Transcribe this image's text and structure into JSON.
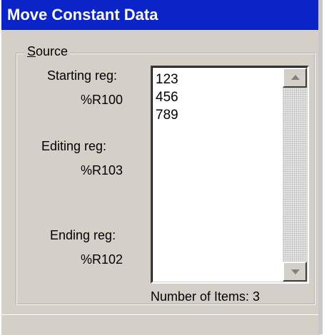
{
  "window": {
    "title": "Move Constant Data"
  },
  "source": {
    "group_label_accel": "S",
    "group_label_rest": "ource",
    "starting_label": "Starting reg:",
    "starting_value": "%R100",
    "editing_label": "Editing reg:",
    "editing_value": "%R103",
    "ending_label": "Ending reg:",
    "ending_value": "%R102"
  },
  "list": {
    "items": [
      "123",
      "456",
      "789"
    ],
    "count_text": "Number of Items: 3"
  },
  "colors": {
    "titlebar": "#0b24c8",
    "dialog_bg": "#d4d0c8"
  },
  "icons": {
    "scroll_up": "triangle-up",
    "scroll_down": "triangle-down"
  }
}
